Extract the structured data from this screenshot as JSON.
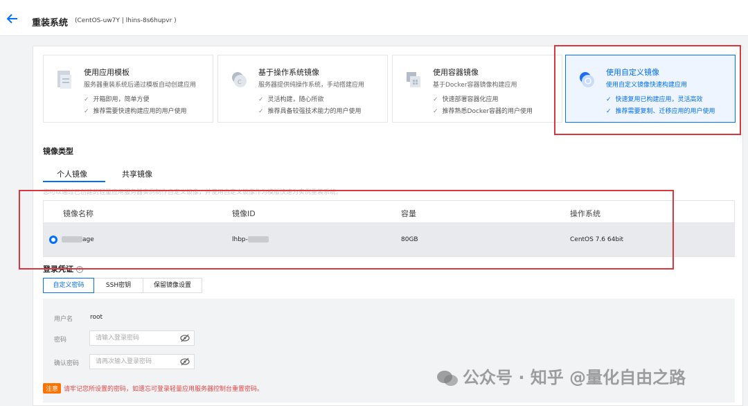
{
  "header": {
    "title": "重装系统",
    "subtitle": "(CentOS-uw7Y | lhins-8s6hupvr )"
  },
  "cards": [
    {
      "icon": "app-template-icon",
      "title": "使用应用模板",
      "desc": "服务器重装系统后通过模板自动创建应用",
      "bullets": [
        "开箱即用，简单方便",
        "推荐需要快速构建应用的用户使用"
      ]
    },
    {
      "icon": "os-image-icon",
      "title": "基于操作系统镜像",
      "desc": "服务器提供纯操作系统，手动搭建应用",
      "bullets": [
        "灵活构建，随心所欲",
        "推荐具备较强技术能力的用户使用"
      ]
    },
    {
      "icon": "container-image-icon",
      "title": "使用容器镜像",
      "desc": "基于Docker容器镜像构建应用",
      "bullets": [
        "快速部署容器化应用",
        "推荐熟悉Docker容器的用户使用"
      ]
    },
    {
      "icon": "custom-image-icon",
      "title": "使用自定义镜像",
      "desc": "使用自定义镜像快速构建应用",
      "bullets": [
        "快速复用已构建应用，灵活高效",
        "推荐需要复制、迁移应用的用户使用"
      ]
    }
  ],
  "image_type": {
    "label": "镜像类型",
    "tabs": [
      "个人镜像",
      "共享镜像"
    ],
    "hint": "您可以通过已创建的轻量应用服务器实例制作自定义镜像，并使用自定义镜像作为模版快速为实例重装系统。"
  },
  "table": {
    "columns": [
      "镜像名称",
      "镜像ID",
      "容量",
      "操作系统"
    ],
    "row": {
      "name_suffix": "age",
      "id_prefix": "lhbp-",
      "size": "80GB",
      "os": "CentOS 7.6 64bit"
    }
  },
  "login": {
    "label": "登录凭证",
    "help_icon": "?",
    "tabs": [
      "自定义密码",
      "SSH密钥",
      "保留镜像设置"
    ],
    "username_label": "用户名",
    "username_value": "root",
    "password_label": "密码",
    "password_placeholder": "请输入登录密码",
    "confirm_label": "确认密码",
    "confirm_placeholder": "请再次输入登录密码"
  },
  "note": {
    "badge": "注意",
    "text": "请牢记您所设置的密码，如遗忘可登录轻量应用服务器控制台重置密码。"
  },
  "watermark": "公众号 · 知乎 @量化自由之路",
  "colors": {
    "accent": "#006eff",
    "highlight_box": "#d9363e",
    "warning": "#ff7200"
  }
}
